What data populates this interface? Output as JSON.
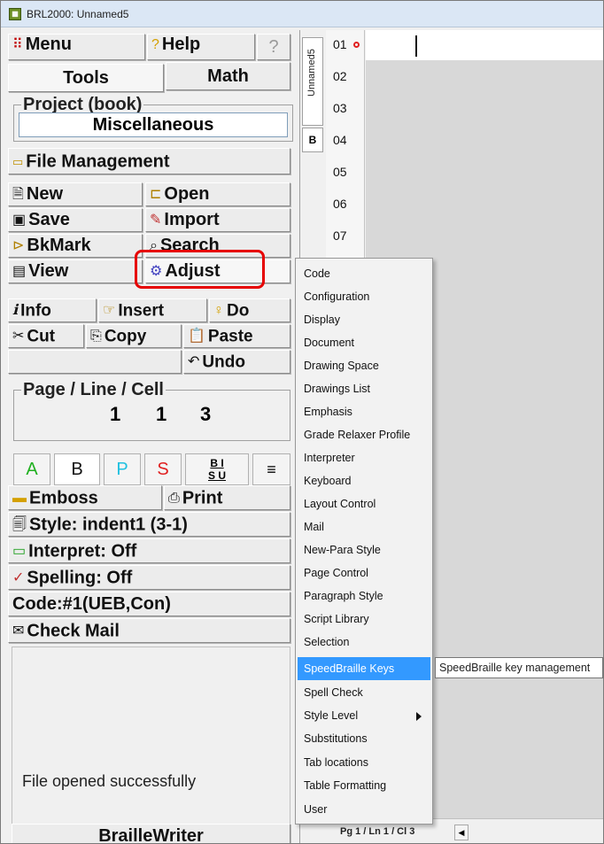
{
  "window": {
    "title": "BRL2000: Unnamed5"
  },
  "left_panel": {
    "menu_label": "Menu",
    "help_label": "Help",
    "help_q_label": "?",
    "tabs": {
      "tools": "Tools",
      "math": "Math"
    },
    "project": {
      "group_label": "Project (book)",
      "value": "Miscellaneous"
    },
    "file_management_label": "File Management",
    "buttons": {
      "new": "New",
      "open": "Open",
      "save": "Save",
      "import": "Import",
      "bkmark": "BkMark",
      "search": "Search",
      "view": "View",
      "adjust": "Adjust",
      "info": "Info",
      "insert": "Insert",
      "do": "Do",
      "cut": "Cut",
      "copy": "Copy",
      "paste": "Paste",
      "undo": "Undo"
    },
    "page_line_cell": {
      "label": "Page / Line / Cell",
      "page": "1",
      "line": "1",
      "cell": "3"
    },
    "format_buttons": {
      "a": "A",
      "b": "B",
      "p": "P",
      "s": "S",
      "bi_top": "B I",
      "bi_bottom": "S U",
      "align": "≡"
    },
    "emboss": "Emboss",
    "print": "Print",
    "style": "Style: indent1 (3-1)",
    "interpret": "Interpret: Off",
    "spelling": "Spelling: Off",
    "code": "Code:#1(UEB,Con)",
    "check_mail": "Check Mail",
    "status_message": "File opened successfully",
    "braillewriter": "BrailleWriter"
  },
  "doc_tabs": {
    "unnamed": "Unnamed5",
    "b": "B"
  },
  "line_numbers": [
    "01",
    "02",
    "03",
    "04",
    "05",
    "06",
    "07"
  ],
  "status_bar": {
    "position": "Pg 1 / Ln 1 / Cl 3"
  },
  "adjust_menu": {
    "items": [
      "Code",
      "Configuration",
      "Display",
      "Document",
      "Drawing Space",
      "Drawings List",
      "Emphasis",
      "Grade Relaxer Profile",
      "Interpreter",
      "Keyboard",
      "Layout Control",
      "Mail",
      "New-Para Style",
      "Page Control",
      "Paragraph Style",
      "Script Library",
      "Selection",
      "SpeedBraille Keys",
      "Spell Check",
      "Style Level",
      "Substitutions",
      "Tab locations",
      "Table Formatting",
      "User"
    ],
    "highlighted": "SpeedBraille Keys",
    "tooltip": "SpeedBraille key management"
  },
  "colors": {
    "highlight": "#3399ff",
    "annotation_red": "#e60000",
    "format_a": "#20b020",
    "format_p": "#20c0e0",
    "format_s": "#e02020"
  }
}
